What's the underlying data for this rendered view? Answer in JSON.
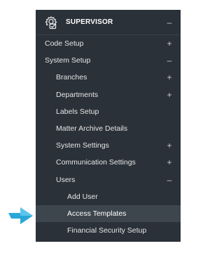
{
  "header": {
    "title": "SUPERVISOR",
    "toggle": "–"
  },
  "menu": [
    {
      "label": "Code Setup",
      "toggle": "+"
    },
    {
      "label": "System Setup",
      "toggle": "–"
    },
    {
      "label": "Branches",
      "toggle": "+"
    },
    {
      "label": "Departments",
      "toggle": "+"
    },
    {
      "label": "Labels Setup",
      "toggle": ""
    },
    {
      "label": "Matter Archive Details",
      "toggle": ""
    },
    {
      "label": "System Settings",
      "toggle": "+"
    },
    {
      "label": "Communication Settings",
      "toggle": "+"
    },
    {
      "label": "Users",
      "toggle": "–"
    },
    {
      "label": "Add User",
      "toggle": ""
    },
    {
      "label": "Access Templates",
      "toggle": ""
    },
    {
      "label": "Financial Security Setup",
      "toggle": ""
    }
  ],
  "colors": {
    "sidebar_bg": "#2b3138",
    "active_bg": "#3d454d",
    "arrow": "#2aa7d9"
  },
  "icons": {
    "header": "gear-check-icon",
    "pointer": "pointer-arrow-icon"
  }
}
